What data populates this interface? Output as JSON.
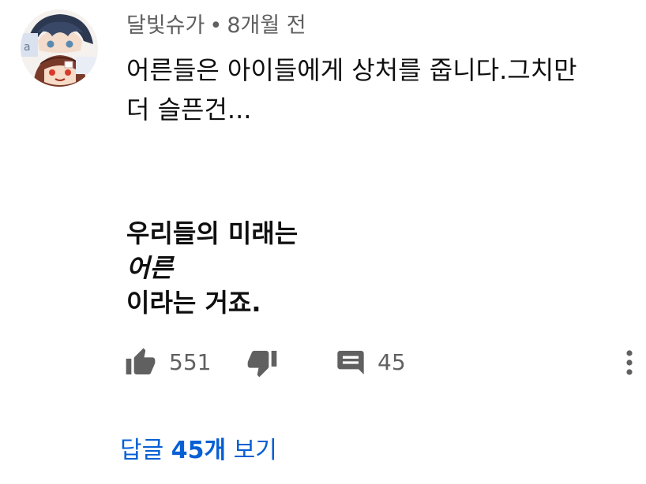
{
  "comment": {
    "author": "달빛슈가",
    "separator": "•",
    "time": "8개월 전",
    "text_lines": [
      "어른들은 아이들에게 상처를 줍니다.그치만",
      "더 슬픈건..."
    ],
    "bold_lines": [
      "우리들의 미래는",
      "어른",
      "이라는 거죠."
    ]
  },
  "actions": {
    "like_icon": "thumbs-up-icon",
    "like_count": "551",
    "dislike_icon": "thumbs-down-icon",
    "reply_icon": "comment-icon",
    "reply_count": "45",
    "more_icon": "more-vert-icon"
  },
  "replies": {
    "prefix": "답글",
    "count": "45개",
    "suffix": "보기"
  },
  "colors": {
    "text": "#0f0f0f",
    "secondary": "#606060",
    "link": "#065fd4",
    "background": "#ffffff"
  }
}
